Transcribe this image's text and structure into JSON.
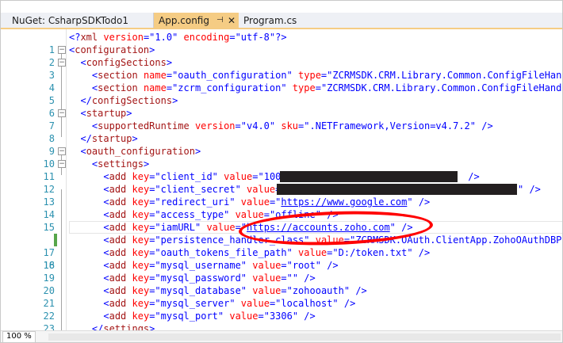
{
  "tabs": {
    "project": "NuGet: CsharpSDKTodo1",
    "active": "App.config",
    "pin_icon": "⊣",
    "close_icon": "✕",
    "other": "Program.cs"
  },
  "status": {
    "zoom": "100 %"
  },
  "lines": [
    {
      "n": "1"
    },
    {
      "n": "2"
    },
    {
      "n": "3"
    },
    {
      "n": "4"
    },
    {
      "n": "5"
    },
    {
      "n": "6"
    },
    {
      "n": "7"
    },
    {
      "n": "8"
    },
    {
      "n": "9"
    },
    {
      "n": "10"
    },
    {
      "n": "11"
    },
    {
      "n": "12"
    },
    {
      "n": "13"
    },
    {
      "n": "14"
    },
    {
      "n": "15"
    },
    {
      "n": "16"
    },
    {
      "n": "17"
    },
    {
      "n": "18"
    },
    {
      "n": "19"
    },
    {
      "n": "20"
    },
    {
      "n": "21"
    },
    {
      "n": "22"
    },
    {
      "n": "23"
    }
  ],
  "code": {
    "l1": {
      "open": "<?",
      "tag": "xml",
      "a1": " version",
      "eq1": "=",
      "v1": "\"1.0\"",
      "a2": " encoding",
      "eq2": "=",
      "v2": "\"utf-8\"",
      "close": "?>"
    },
    "l2": {
      "open": "<",
      "tag": "configuration",
      "close": ">"
    },
    "l3": {
      "open": "<",
      "tag": "configSections",
      "close": ">"
    },
    "l4": {
      "open": "<",
      "tag": "section",
      "a1": " name",
      "eq1": "=",
      "v1": "\"oauth_configuration\"",
      "a2": " type",
      "eq2": "=",
      "v2": "\"ZCRMSDK.CRM.Library.Common.ConfigFileHandl"
    },
    "l5": {
      "open": "<",
      "tag": "section",
      "a1": " name",
      "eq1": "=",
      "v1": "\"zcrm_configuration\"",
      "a2": " type",
      "eq2": "=",
      "v2": "\"ZCRMSDK.CRM.Library.Common.ConfigFileHandle"
    },
    "l6": {
      "open": "</",
      "tag": "configSections",
      "close": ">"
    },
    "l7": {
      "open": "<",
      "tag": "startup",
      "close": ">"
    },
    "l8": {
      "open": "<",
      "tag": "supportedRuntime",
      "a1": " version",
      "eq1": "=",
      "v1": "\"v4.0\"",
      "a2": " sku",
      "eq2": "=",
      "v2": "\".NETFramework,Version=v4.7.2\"",
      "close": " />"
    },
    "l9": {
      "open": "</",
      "tag": "startup",
      "close": ">"
    },
    "l10": {
      "open": "<",
      "tag": "oauth_configuration",
      "close": ">"
    },
    "l11": {
      "open": "<",
      "tag": "settings",
      "close": ">"
    },
    "l12": {
      "open": "<",
      "tag": "add",
      "a1": " key",
      "eq1": "=",
      "v1": "\"client_id\"",
      "a2": " value",
      "eq2": "=",
      "v2": "\"1000",
      "close": " />"
    },
    "l13": {
      "open": "<",
      "tag": "add",
      "a1": " key",
      "eq1": "=",
      "v1": "\"client_secret\"",
      "a2": " value",
      "eq2": "=",
      "v2": "\"",
      "v2end": "\"",
      "close": " />"
    },
    "l14": {
      "open": "<",
      "tag": "add",
      "a1": " key",
      "eq1": "=",
      "v1": "\"redirect_uri\"",
      "a2": " value",
      "eq2": "=",
      "v2": "\"",
      "v2u": "https://www.google.com",
      "v2end": "\"",
      "close": " />"
    },
    "l15": {
      "open": "<",
      "tag": "add",
      "a1": " key",
      "eq1": "=",
      "v1": "\"access_type\"",
      "a2": " value",
      "eq2": "=",
      "v2": "\"offline\"",
      "close": " />"
    },
    "l16": {
      "open": "<",
      "tag": "add",
      "a1": " key",
      "eq1": "=",
      "v1": "\"iamURL\"",
      "a2": " value",
      "eq2": "=",
      "v2": "\"",
      "v2u": "https://accounts.zoho.com",
      "v2end": "\"",
      "close": " />"
    },
    "l17": {
      "open": "<",
      "tag": "add",
      "a1": " key",
      "eq1": "=",
      "v1": "\"persistence_handler_class\"",
      "a2": " value",
      "eq2": "=",
      "v2": "\"ZCRMSDK.OAuth.ClientApp.ZohoOAuthDBPer"
    },
    "l18": {
      "open": "<",
      "tag": "add",
      "a1": " key",
      "eq1": "=",
      "v1": "\"oauth_tokens_file_path\"",
      "a2": " value",
      "eq2": "=",
      "v2": "\"D:/token.txt\"",
      "close": " />"
    },
    "l19": {
      "open": "<",
      "tag": "add",
      "a1": " key",
      "eq1": "=",
      "v1": "\"mysql_username\"",
      "a2": " value",
      "eq2": "=",
      "v2": "\"root\"",
      "close": " />"
    },
    "l20": {
      "open": "<",
      "tag": "add",
      "a1": " key",
      "eq1": "=",
      "v1": "\"mysql_password\"",
      "a2": " value",
      "eq2": "=",
      "v2": "\"\"",
      "close": " />"
    },
    "l21": {
      "open": "<",
      "tag": "add",
      "a1": " key",
      "eq1": "=",
      "v1": "\"mysql_database\"",
      "a2": " value",
      "eq2": "=",
      "v2": "\"zohooauth\"",
      "close": " />"
    },
    "l22": {
      "open": "<",
      "tag": "add",
      "a1": " key",
      "eq1": "=",
      "v1": "\"mysql_server\"",
      "a2": " value",
      "eq2": "=",
      "v2": "\"localhost\"",
      "close": " />"
    },
    "l23": {
      "open": "<",
      "tag": "add",
      "a1": " key",
      "eq1": "=",
      "v1": "\"mysql_port\"",
      "a2": " value",
      "eq2": "=",
      "v2": "\"3306\"",
      "close": " />"
    },
    "l24": {
      "open": "</",
      "tag": "settings",
      "close": ">"
    }
  },
  "colors": {
    "active_tab": "#f5cc84",
    "line_number": "#2b91af",
    "xml_tag": "#a31515",
    "xml_attr": "#ff0000",
    "xml_value": "#0000ff",
    "annotation": "#ff0000",
    "change_marker": "#57a64a"
  }
}
